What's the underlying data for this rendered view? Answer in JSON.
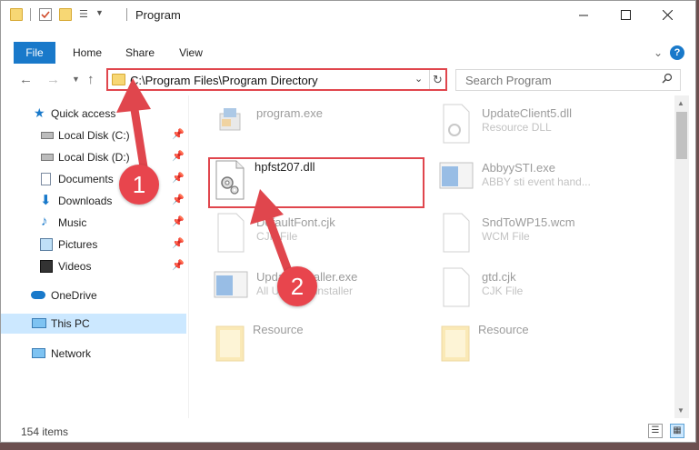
{
  "window": {
    "title": "Program"
  },
  "ribbon": {
    "tabs": [
      {
        "label": "File"
      },
      {
        "label": "Home"
      },
      {
        "label": "Share"
      },
      {
        "label": "View"
      }
    ],
    "collapse_icon": "chevron-down-icon",
    "help_label": "?"
  },
  "navbar": {
    "address": "C:\\Program Files\\Program Directory",
    "search_placeholder": "Search Program"
  },
  "sidebar": {
    "items": [
      {
        "label": "Quick access",
        "icon": "star-icon"
      },
      {
        "label": "Local Disk (C:)",
        "icon": "drive-icon",
        "pinned": true
      },
      {
        "label": "Local Disk (D:)",
        "icon": "drive-icon",
        "pinned": true
      },
      {
        "label": "Documents",
        "icon": "documents-icon",
        "pinned": true
      },
      {
        "label": "Downloads",
        "icon": "download-icon",
        "pinned": true
      },
      {
        "label": "Music",
        "icon": "music-icon",
        "pinned": true
      },
      {
        "label": "Pictures",
        "icon": "pictures-icon",
        "pinned": true
      },
      {
        "label": "Videos",
        "icon": "videos-icon",
        "pinned": true
      },
      {
        "label": "OneDrive",
        "icon": "cloud-icon"
      },
      {
        "label": "This PC",
        "icon": "computer-icon",
        "selected": true
      },
      {
        "label": "Network",
        "icon": "network-icon"
      }
    ]
  },
  "files": [
    {
      "name": "program.exe",
      "type": "",
      "icon": "app-icon"
    },
    {
      "name": "UpdateClient5.dll",
      "type": "Resource DLL",
      "icon": "dll-icon"
    },
    {
      "name": "hpfst207.dll",
      "type": "",
      "icon": "dll-gear-icon"
    },
    {
      "name": "AbbyySTI.exe",
      "type": "ABBY sti event hand...",
      "icon": "window-app-icon"
    },
    {
      "name": "DefaultFont.cjk",
      "type": "CJK File",
      "icon": "document-icon"
    },
    {
      "name": "SndToWP15.wcm",
      "type": "WCM File",
      "icon": "document-icon"
    },
    {
      "name": "UpdateInstaller.exe",
      "type": "All Updates installer",
      "icon": "window-app-icon"
    },
    {
      "name": "gtd.cjk",
      "type": "CJK File",
      "icon": "document-icon"
    },
    {
      "name": "Resource",
      "type": "",
      "icon": "folder-icon"
    },
    {
      "name": "Resource",
      "type": "",
      "icon": "folder-icon"
    }
  ],
  "status": {
    "item_count": "154 items"
  },
  "annotations": [
    {
      "label": "1"
    },
    {
      "label": "2"
    }
  ],
  "colors": {
    "accent": "#1979ca",
    "highlight": "#e0464d",
    "selection": "#cce8ff"
  }
}
